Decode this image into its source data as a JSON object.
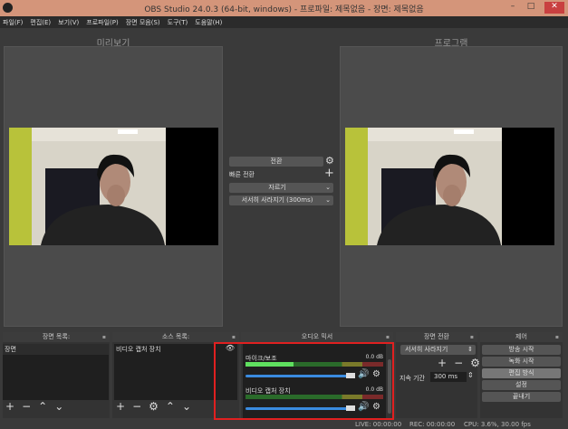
{
  "window": {
    "title": "OBS Studio 24.0.3 (64-bit, windows) - 프로파일: 제목없음 - 장면: 제목없음",
    "minimize": "–",
    "maximize": "□",
    "close": "✕"
  },
  "menu": [
    "파일(F)",
    "편집(E)",
    "보기(V)",
    "프로파일(P)",
    "장면 모음(S)",
    "도구(T)",
    "도움말(H)"
  ],
  "preview": {
    "label": "미리보기"
  },
  "program": {
    "label": "프로그램"
  },
  "transition_center": {
    "transition_button": "전환",
    "quick_transition": "빠른 전환",
    "cut": "자르기",
    "fade": "서서히 사라지기 (300ms)"
  },
  "docks": {
    "scenes": {
      "title": "장면 목록:",
      "items": [
        "장면"
      ]
    },
    "sources": {
      "title": "소스 목록:",
      "items": [
        "비디오 캡처 장치"
      ]
    },
    "mixer": {
      "title": "오디오 믹서",
      "channels": [
        {
          "name": "마이크/보조",
          "db": "0.0 dB",
          "level": 0.35
        },
        {
          "name": "비디오 캡처 장치",
          "db": "0.0 dB",
          "level": 0
        }
      ]
    },
    "transitions": {
      "title": "장면 전환",
      "selected": "서서히 사라지기",
      "duration_label": "지속 기간",
      "duration": "300 ms"
    },
    "controls": {
      "title": "제어",
      "buttons": [
        "방송 시작",
        "녹화 시작",
        "편집 방식",
        "설정",
        "끝내기"
      ]
    }
  },
  "status": {
    "live": "LIVE: 00:00:00",
    "rec": "REC: 00:00:00",
    "cpu": "CPU: 3.6%, 30.00 fps"
  },
  "colors": {
    "titlebar": "#d4957a",
    "highlight": "#e02020",
    "fader": "#3a8be0"
  }
}
